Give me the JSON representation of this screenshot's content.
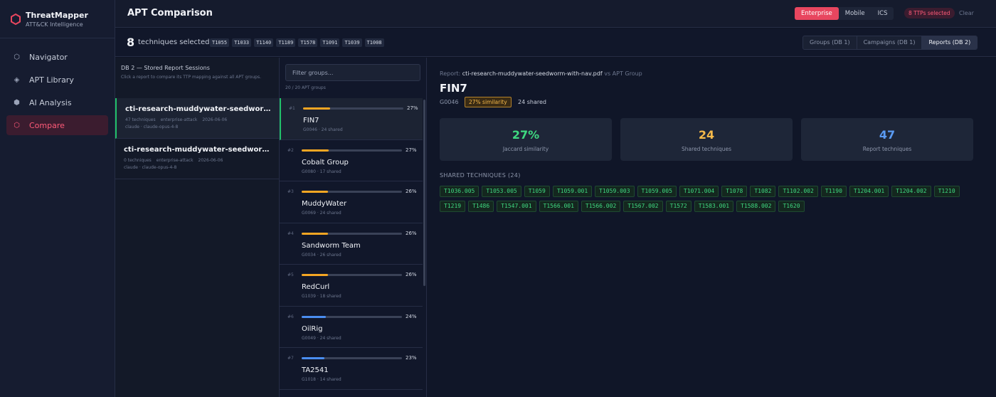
{
  "brand": {
    "name": "ThreatMapper",
    "subtitle": "ATT&CK Intelligence",
    "logo_icon": "hexagon-logo-icon",
    "accent": "#e8465f"
  },
  "nav": [
    {
      "label": "Navigator",
      "icon": "hexagon-outline-icon",
      "active": false
    },
    {
      "label": "APT Library",
      "icon": "diamond-icon",
      "active": false
    },
    {
      "label": "AI Analysis",
      "icon": "hexagon-filled-icon",
      "active": false
    },
    {
      "label": "Compare",
      "icon": "hexagon-outline-icon",
      "active": true
    }
  ],
  "header": {
    "title": "APT Comparison",
    "domains": [
      "Enterprise",
      "Mobile",
      "ICS"
    ],
    "active_domain": "Enterprise",
    "ttp_badge": "8 TTPs selected",
    "clear": "Clear"
  },
  "selection": {
    "count": "8",
    "label": "techniques selected",
    "techniques": [
      "T1055",
      "T1033",
      "T1140",
      "T1189",
      "T1578",
      "T1091",
      "T1039",
      "T1008"
    ],
    "source_tabs": [
      "Groups (DB 1)",
      "Campaigns (DB 1)",
      "Reports (DB 2)"
    ],
    "active_source": "Reports (DB 2)"
  },
  "reports_panel": {
    "title": "DB 2 — Stored Report Sessions",
    "hint": "Click a report to compare its TTP mapping against all APT groups.",
    "items": [
      {
        "name": "cti-research-muddywater-seedworm-with-nav.pdf",
        "techniques": "47 techniques",
        "domain": "enterprise-attack",
        "date": "2026-06-06",
        "model": "claude · claude-opus-4-8",
        "active": true
      },
      {
        "name": "cti-research-muddywater-seedworm-with-nav.pdf",
        "techniques": "0 techniques",
        "domain": "enterprise-attack",
        "date": "2026-06-06",
        "model": "claude · claude-opus-4-8",
        "active": false
      }
    ]
  },
  "groups_panel": {
    "filter_placeholder": "Filter groups...",
    "count": "20 / 20 APT groups",
    "items": [
      {
        "rank": "#1",
        "name": "FIN7",
        "meta": "G0046 · 24 shared",
        "pct": "27%",
        "value": 0.27,
        "color": "#f5a623",
        "active": true
      },
      {
        "rank": "#2",
        "name": "Cobalt Group",
        "meta": "G0080 · 17 shared",
        "pct": "27%",
        "value": 0.27,
        "color": "#f5a623",
        "active": false
      },
      {
        "rank": "#3",
        "name": "MuddyWater",
        "meta": "G0069 · 24 shared",
        "pct": "26%",
        "value": 0.26,
        "color": "#f5a623",
        "active": false
      },
      {
        "rank": "#4",
        "name": "Sandworm Team",
        "meta": "G0034 · 26 shared",
        "pct": "26%",
        "value": 0.26,
        "color": "#f5a623",
        "active": false
      },
      {
        "rank": "#5",
        "name": "RedCurl",
        "meta": "G1039 · 18 shared",
        "pct": "26%",
        "value": 0.26,
        "color": "#f5a623",
        "active": false
      },
      {
        "rank": "#6",
        "name": "OilRig",
        "meta": "G0049 · 24 shared",
        "pct": "24%",
        "value": 0.24,
        "color": "#4a8df0",
        "active": false
      },
      {
        "rank": "#7",
        "name": "TA2541",
        "meta": "G1018 · 14 shared",
        "pct": "23%",
        "value": 0.23,
        "color": "#4a8df0",
        "active": false
      }
    ]
  },
  "detail": {
    "report_prefix": "Report:",
    "report_name": "cti-research-muddywater-seedworm-with-nav.pdf",
    "report_suffix": "vs APT Group",
    "group_name": "FIN7",
    "group_id": "G0046",
    "similarity_badge": "27% similarity",
    "shared_text": "24 shared",
    "stats": [
      {
        "value": "27%",
        "label": "Jaccard similarity",
        "color": "#3fd980"
      },
      {
        "value": "24",
        "label": "Shared techniques",
        "color": "#f5b94a"
      },
      {
        "value": "47",
        "label": "Report techniques",
        "color": "#5a9af2"
      }
    ],
    "shared_title": "SHARED TECHNIQUES (24)",
    "shared": [
      "T1036.005",
      "T1053.005",
      "T1059",
      "T1059.001",
      "T1059.003",
      "T1059.005",
      "T1071.004",
      "T1078",
      "T1082",
      "T1102.002",
      "T1190",
      "T1204.001",
      "T1204.002",
      "T1210",
      "T1219",
      "T1486",
      "T1547.001",
      "T1566.001",
      "T1566.002",
      "T1567.002",
      "T1572",
      "T1583.001",
      "T1588.002",
      "T1620"
    ]
  }
}
